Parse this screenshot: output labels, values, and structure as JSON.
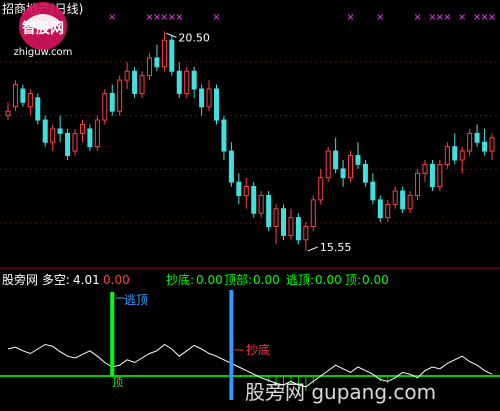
{
  "title": "招商地产(日线)",
  "price_high_label": "20.50",
  "price_low_label": "15.55",
  "indicator": {
    "name": "股旁网 多空:",
    "duokong_value": "4.01",
    "red_value": "0.00",
    "items": [
      {
        "label": "抄底:",
        "value": "0.00"
      },
      {
        "label": "顶部:",
        "value": "0.00"
      },
      {
        "label": "逃顶:",
        "value": "0.00"
      },
      {
        "label": "顶:",
        "value": "0.00"
      }
    ]
  },
  "annotations": {
    "escape": "逃顶",
    "bottom": "抄底",
    "top": "顶"
  },
  "watermark": {
    "text": "股旁网 gupang.com",
    "logo_text": "智股网",
    "logo_url": "zhiguw.com"
  },
  "colors": {
    "up": "#ff4040",
    "down": "#40e0e0",
    "grid": "#800000",
    "escape": "#00ff00",
    "bottom": "#3399ff",
    "signal": "#ff33ff",
    "line": "#ffffff",
    "baseline": "#00cc00"
  },
  "chart_data": {
    "type": "candlestick",
    "title": "招商地产(日线)",
    "max_price": 20.5,
    "min_price": 15.55,
    "ylim": [
      15.3,
      20.8
    ],
    "candles": [
      [
        18.6,
        18.9,
        18.5,
        18.7
      ],
      [
        18.8,
        19.4,
        18.7,
        19.3
      ],
      [
        19.2,
        19.3,
        18.8,
        18.9
      ],
      [
        18.8,
        19.2,
        18.6,
        19.1
      ],
      [
        19.0,
        19.1,
        18.4,
        18.5
      ],
      [
        18.5,
        18.6,
        17.9,
        18.0
      ],
      [
        18.0,
        18.4,
        17.8,
        18.3
      ],
      [
        18.3,
        18.6,
        18.0,
        18.2
      ],
      [
        18.2,
        18.3,
        17.6,
        17.7
      ],
      [
        17.8,
        18.3,
        17.7,
        18.2
      ],
      [
        18.2,
        18.5,
        18.0,
        18.4
      ],
      [
        18.3,
        18.4,
        17.8,
        17.9
      ],
      [
        17.9,
        18.6,
        17.8,
        18.5
      ],
      [
        18.5,
        19.2,
        18.4,
        19.1
      ],
      [
        19.1,
        19.3,
        18.6,
        18.7
      ],
      [
        18.7,
        19.5,
        18.6,
        19.4
      ],
      [
        19.4,
        19.8,
        19.2,
        19.6
      ],
      [
        19.6,
        19.7,
        19.0,
        19.1
      ],
      [
        19.1,
        19.6,
        19.0,
        19.5
      ],
      [
        19.5,
        20.0,
        19.4,
        19.9
      ],
      [
        19.9,
        20.2,
        19.6,
        19.7
      ],
      [
        19.7,
        20.5,
        19.6,
        20.3
      ],
      [
        20.3,
        20.4,
        19.5,
        19.6
      ],
      [
        19.6,
        19.8,
        19.0,
        19.1
      ],
      [
        19.1,
        19.7,
        19.0,
        19.6
      ],
      [
        19.6,
        19.7,
        19.0,
        19.2
      ],
      [
        19.2,
        19.3,
        18.6,
        18.8
      ],
      [
        18.8,
        19.4,
        18.7,
        19.2
      ],
      [
        19.2,
        19.3,
        18.4,
        18.5
      ],
      [
        18.5,
        18.6,
        17.6,
        17.8
      ],
      [
        17.8,
        18.0,
        17.0,
        17.1
      ],
      [
        17.1,
        17.3,
        16.6,
        16.8
      ],
      [
        16.8,
        17.2,
        16.5,
        17.0
      ],
      [
        17.0,
        17.1,
        16.3,
        16.4
      ],
      [
        16.4,
        16.9,
        16.3,
        16.8
      ],
      [
        16.8,
        16.9,
        16.0,
        16.1
      ],
      [
        16.1,
        16.6,
        15.7,
        16.5
      ],
      [
        16.5,
        16.6,
        15.8,
        15.9
      ],
      [
        15.9,
        16.5,
        15.8,
        16.3
      ],
      [
        16.3,
        16.4,
        15.7,
        15.8
      ],
      [
        15.8,
        16.2,
        15.55,
        16.1
      ],
      [
        16.1,
        16.8,
        16.0,
        16.7
      ],
      [
        16.7,
        17.4,
        16.6,
        17.2
      ],
      [
        17.2,
        17.9,
        17.1,
        17.8
      ],
      [
        17.8,
        18.1,
        17.3,
        17.4
      ],
      [
        17.4,
        17.6,
        17.0,
        17.2
      ],
      [
        17.2,
        17.8,
        17.1,
        17.7
      ],
      [
        17.7,
        18.0,
        17.4,
        17.5
      ],
      [
        17.5,
        17.6,
        17.0,
        17.1
      ],
      [
        17.1,
        17.3,
        16.6,
        16.7
      ],
      [
        16.7,
        16.8,
        16.2,
        16.3
      ],
      [
        16.3,
        16.7,
        16.2,
        16.6
      ],
      [
        16.6,
        17.0,
        16.5,
        16.9
      ],
      [
        16.9,
        17.0,
        16.4,
        16.5
      ],
      [
        16.5,
        16.9,
        16.4,
        16.8
      ],
      [
        16.8,
        17.4,
        16.7,
        17.3
      ],
      [
        17.3,
        17.6,
        17.1,
        17.5
      ],
      [
        17.5,
        17.6,
        16.9,
        17.0
      ],
      [
        17.0,
        17.6,
        16.9,
        17.5
      ],
      [
        17.5,
        18.0,
        17.4,
        17.9
      ],
      [
        17.9,
        18.2,
        17.5,
        17.6
      ],
      [
        17.6,
        17.9,
        17.3,
        17.8
      ],
      [
        17.8,
        18.3,
        17.7,
        18.2
      ],
      [
        18.2,
        18.4,
        17.9,
        18.0
      ],
      [
        18.0,
        18.3,
        17.7,
        17.8
      ],
      [
        17.8,
        18.2,
        17.6,
        18.1
      ]
    ],
    "indicator_line": [
      0.3,
      0.32,
      0.28,
      0.25,
      0.3,
      0.35,
      0.33,
      0.27,
      0.22,
      0.2,
      0.24,
      0.28,
      0.22,
      0.15,
      0.1,
      0.12,
      0.18,
      0.15,
      0.2,
      0.25,
      0.28,
      0.35,
      0.3,
      0.22,
      0.28,
      0.34,
      0.3,
      0.25,
      0.22,
      0.18,
      0.14,
      0.1,
      0.06,
      0.02,
      -0.02,
      -0.05,
      -0.08,
      -0.1,
      -0.06,
      -0.1,
      -0.12,
      -0.06,
      0.0,
      0.06,
      0.12,
      0.08,
      0.04,
      0.1,
      0.06,
      0.02,
      -0.04,
      -0.06,
      -0.02,
      0.04,
      0.02,
      -0.02,
      0.06,
      0.1,
      0.08,
      0.14,
      0.18,
      0.22,
      0.16,
      0.12,
      0.06,
      0.02
    ],
    "escape_signal_index": 14,
    "bottom_signal_index": 30,
    "top_marker_indices": [
      14,
      19,
      20,
      21,
      22,
      23,
      28,
      46,
      50,
      55,
      57,
      58,
      59,
      61,
      63,
      64,
      65
    ]
  }
}
